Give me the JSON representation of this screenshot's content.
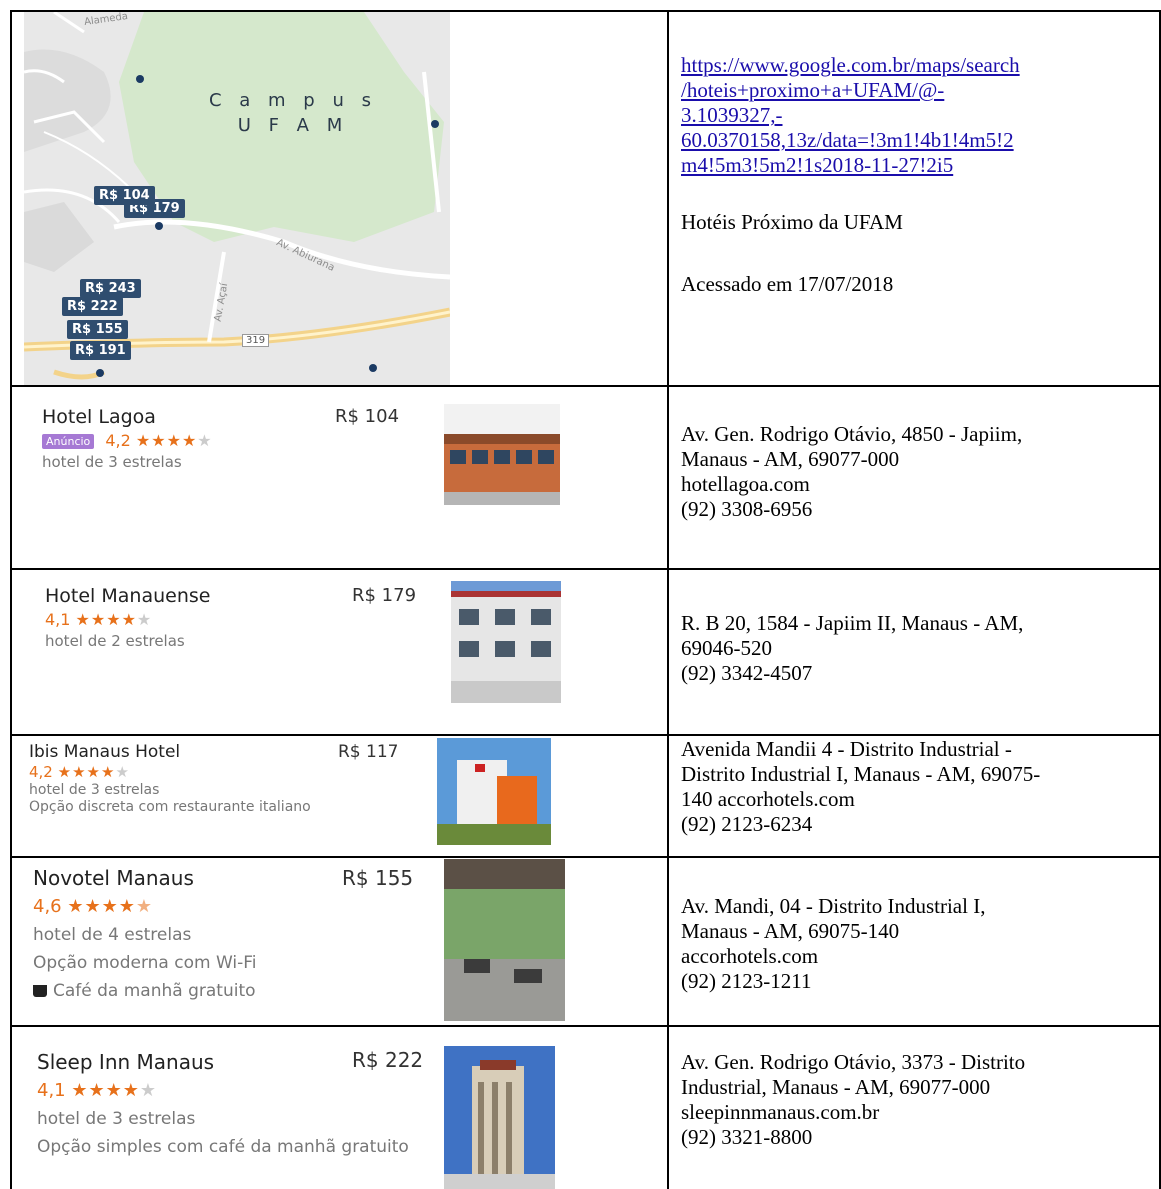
{
  "map": {
    "campus_line1": "C a m p u s",
    "campus_line2": "U F A M",
    "roads": [
      "Alameda",
      "Av. Abiurana",
      "Av. Açaí",
      "319"
    ],
    "pins": [
      "R$ 104",
      "R$ 179",
      "R$ 243",
      "R$ 222",
      "R$ 155",
      "R$ 191"
    ]
  },
  "source": {
    "url_lines": [
      "https://www.google.com.br/maps/search",
      "/hoteis+proximo+a+UFAM/@-",
      "3.1039327,-",
      "60.0370158,13z/data=!3m1!4b1!4m5!2",
      "m4!5m3!5m2!1s2018-11-27!2i5"
    ],
    "title": "Hotéis Próximo da UFAM",
    "accessed": "Acessado em 17/07/2018"
  },
  "hotels": [
    {
      "name": "Hotel Lagoa",
      "price": "R$ 104",
      "ad_label": "Anúncio",
      "rating": "4,2",
      "stars_full": "★★★★",
      "stars_empty": "★",
      "class": "hotel de 3 estrelas",
      "lines": [
        "Av. Gen. Rodrigo Otávio, 4850 - Japiim,",
        "Manaus - AM, 69077-000",
        "hotellagoa.com",
        "(92) 3308-6956"
      ]
    },
    {
      "name": "Hotel Manauense",
      "price": "R$ 179",
      "rating": "4,1",
      "stars_full": "★★★★",
      "stars_empty": "★",
      "class": "hotel de 2 estrelas",
      "lines": [
        "R. B 20, 1584 - Japiim II, Manaus - AM,",
        "69046-520",
        "(92) 3342-4507"
      ]
    },
    {
      "name": "Ibis Manaus Hotel",
      "price": "R$ 117",
      "rating": "4,2",
      "stars_full": "★★★★",
      "stars_empty": "★",
      "class": "hotel de 3 estrelas",
      "extra": "Opção discreta com restaurante italiano",
      "lines": [
        "Avenida Mandii 4 - Distrito Industrial -",
        "Distrito Industrial I, Manaus - AM, 69075-",
        "140 accorhotels.com",
        "(92) 2123-6234"
      ]
    },
    {
      "name": "Novotel Manaus",
      "price": "R$ 155",
      "rating": "4,6",
      "stars_full": "★★★★",
      "stars_empty": "★",
      "class": "hotel de 4 estrelas",
      "extra": "Opção moderna com Wi-Fi",
      "amenity": "Café da manhã gratuito",
      "lines": [
        "Av. Mandi, 04 - Distrito Industrial I,",
        "Manaus - AM, 69075-140",
        "accorhotels.com",
        "(92) 2123-1211"
      ]
    },
    {
      "name": "Sleep Inn Manaus",
      "price": "R$ 222",
      "rating": "4,1",
      "stars_full": "★★★★",
      "stars_empty": "★",
      "class": "hotel de 3 estrelas",
      "extra": "Opção simples com café da manhã gratuito",
      "lines": [
        "Av. Gen. Rodrigo Otávio, 3373 - Distrito",
        "Industrial, Manaus - AM, 69077-000",
        "sleepinnmanaus.com.br",
        "(92) 3321-8800"
      ]
    }
  ]
}
